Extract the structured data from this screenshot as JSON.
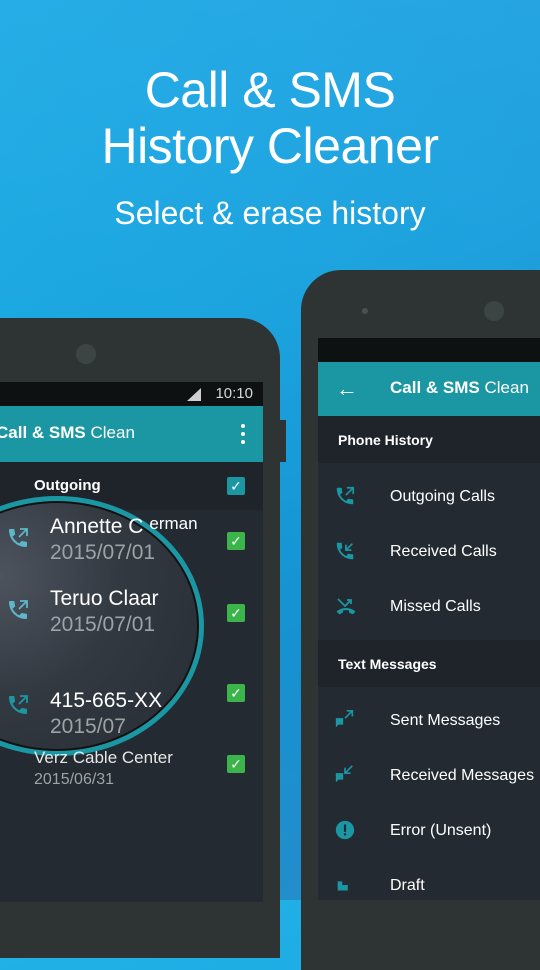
{
  "hero": {
    "title_line1": "Call & SMS",
    "title_line2": "History Cleaner",
    "subtitle": "Select & erase history"
  },
  "colors": {
    "background": "#1aa6df",
    "accent_teal": "#1b97a4",
    "checkbox_green": "#3bb54a",
    "screen_bg": "#232a31",
    "phone_body": "#2e3434"
  },
  "left_phone": {
    "status_time": "10:10",
    "app_title_bold": "Call & SMS",
    "app_title_light": "Clean",
    "menu_icon": "more-vert-icon",
    "section": {
      "label": "Outgoing",
      "checked": true
    },
    "entries": [
      {
        "name": "Annette Overman",
        "name_visible_in_lens": "Annette C",
        "name_tail": "erman",
        "date": "2015/07/01",
        "icon": "outgoing-call-icon",
        "checked": true
      },
      {
        "name": "Teruo Claar",
        "date": "2015/07/01",
        "icon": "outgoing-call-icon",
        "checked": true
      },
      {
        "name": "415-665-XX",
        "date": "2015/07",
        "icon": "outgoing-call-icon",
        "checked": true
      },
      {
        "name": "Verz Cable Center",
        "date": "2015/06/31",
        "checked": true
      }
    ]
  },
  "right_phone": {
    "app_title_bold": "Call & SMS",
    "app_title_light": "Clean",
    "back_icon": "arrow-back-icon",
    "sections": [
      {
        "label": "Phone History",
        "items": [
          {
            "label": "Outgoing Calls",
            "icon": "outgoing-call-icon"
          },
          {
            "label": "Received Calls",
            "icon": "incoming-call-icon"
          },
          {
            "label": "Missed Calls",
            "icon": "missed-call-icon"
          }
        ]
      },
      {
        "label": "Text Messages",
        "items": [
          {
            "label": "Sent Messages",
            "icon": "sent-message-icon"
          },
          {
            "label": "Received Messages",
            "icon": "received-message-icon"
          },
          {
            "label": "Error (Unsent)",
            "icon": "error-icon"
          },
          {
            "label": "Draft",
            "icon": "draft-icon"
          }
        ]
      }
    ]
  }
}
